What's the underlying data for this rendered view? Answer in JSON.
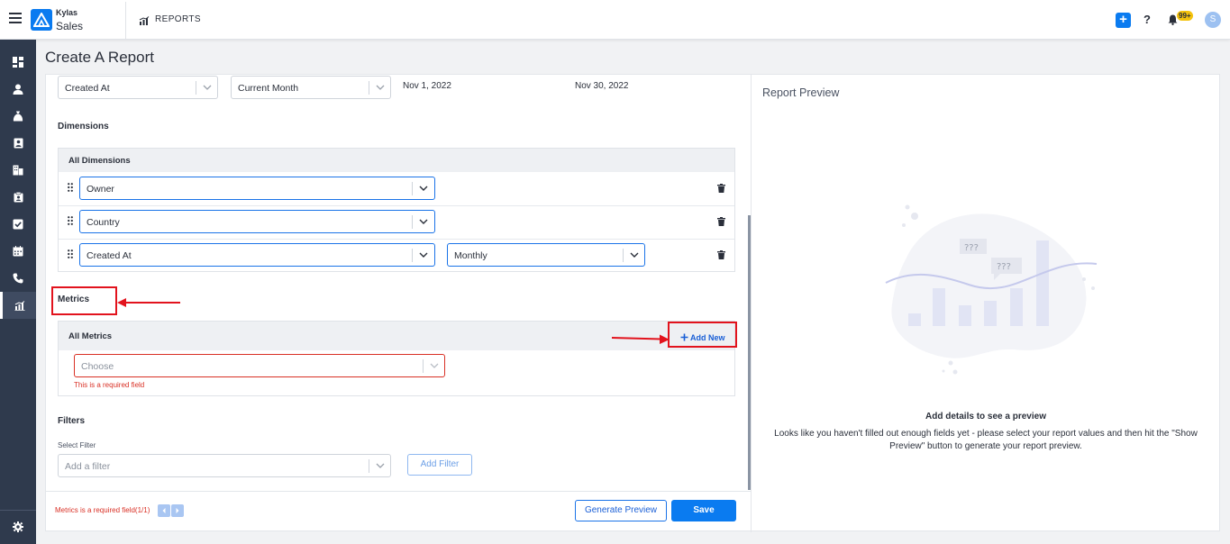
{
  "app": {
    "brand_top": "Kylas",
    "brand_bottom": "Sales",
    "section_title": "REPORTS",
    "notification_count": "99+",
    "avatar_initial": "S",
    "plus_label": "+",
    "help_label": "?"
  },
  "sidebar": {
    "items": [
      {
        "icon": "dashboard-icon"
      },
      {
        "icon": "user-icon"
      },
      {
        "icon": "money-bag-icon"
      },
      {
        "icon": "contact-card-icon"
      },
      {
        "icon": "building-icon"
      },
      {
        "icon": "clipboard-icon"
      },
      {
        "icon": "checkbox-icon"
      },
      {
        "icon": "calendar-icon"
      },
      {
        "icon": "phone-icon"
      },
      {
        "icon": "reports-icon",
        "active": true
      }
    ],
    "bottom_icon": "gear-icon"
  },
  "page": {
    "title": "Create A Report"
  },
  "date_filter": {
    "field": "Created At",
    "range": "Current Month",
    "start": "Nov 1, 2022",
    "end": "Nov 30, 2022"
  },
  "dimensions": {
    "label": "Dimensions",
    "header": "All Dimensions",
    "rows": [
      {
        "value": "Owner"
      },
      {
        "value": "Country"
      },
      {
        "value": "Created At",
        "grouping": "Monthly"
      }
    ]
  },
  "metrics": {
    "label": "Metrics",
    "header": "All Metrics",
    "add_new": "Add New",
    "placeholder": "Choose",
    "error": "This is a required field"
  },
  "filters": {
    "label": "Filters",
    "select_label": "Select Filter",
    "placeholder": "Add a filter",
    "add_button": "Add Filter"
  },
  "footer": {
    "error": "Metrics is a required field(1/1)",
    "generate_preview": "Generate Preview",
    "save": "Save"
  },
  "preview": {
    "title": "Report Preview",
    "bubble_1": "???",
    "bubble_2": "???",
    "heading": "Add details to see a preview",
    "description": "Looks like you haven't filled out enough fields yet - please select your report values and then hit the \"Show Preview\" button to generate your report preview."
  },
  "colors": {
    "accent": "#0a7bf0",
    "sidebar": "#2f3a4d",
    "error": "#d93025",
    "annotation": "#e2131d"
  }
}
